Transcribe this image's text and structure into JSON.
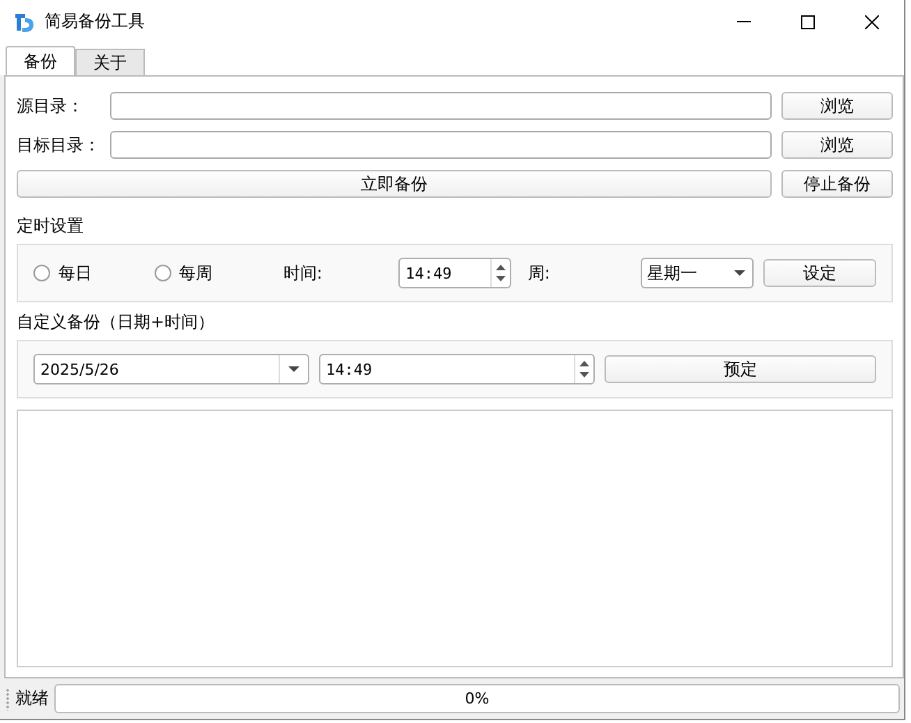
{
  "window": {
    "title": "简易备份工具"
  },
  "tabs": [
    {
      "label": "备份",
      "selected": true
    },
    {
      "label": "关于",
      "selected": false
    }
  ],
  "directories": [
    {
      "label": "源目录：",
      "button": "浏览"
    },
    {
      "label": "目标目录：",
      "button": "浏览"
    }
  ],
  "actions": {
    "start": "立即备份",
    "stop": "停止备份"
  },
  "schedule": {
    "title": "定时设置",
    "modes": [
      {
        "label": "每日",
        "selected": false
      },
      {
        "label": "每周",
        "selected": false
      }
    ],
    "time_label": "时间:",
    "time": "14:49",
    "weekday_label": "周:",
    "weekday": "星期一",
    "set_button": "设定"
  },
  "custom": {
    "title": "自定义备份（日期+时间）",
    "date": "2025/5/26",
    "time": "14:49",
    "button": "预定"
  },
  "status_bar": {
    "text": "就绪",
    "progress": {
      "level": 0,
      "reading": "0%"
    }
  }
}
